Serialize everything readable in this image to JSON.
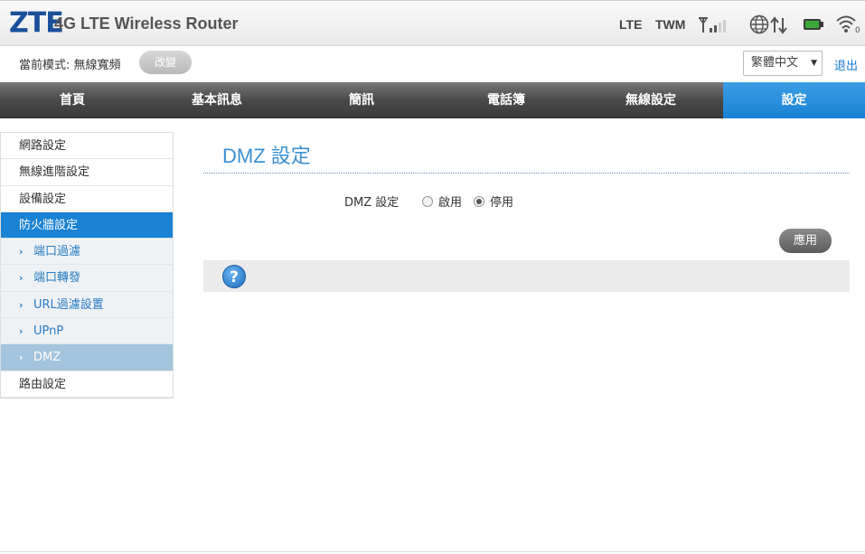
{
  "header": {
    "logo": "ZTE",
    "product": "4G LTE Wireless Router",
    "network_type": "LTE",
    "operator": "TWM",
    "wifi_clients": "0"
  },
  "subbar": {
    "mode_label": "當前模式: 無線寬頻",
    "mode_button": "改變",
    "language": "繁體中文",
    "logout": "退出"
  },
  "nav": {
    "items": [
      {
        "label": "首頁"
      },
      {
        "label": "基本訊息"
      },
      {
        "label": "簡訊"
      },
      {
        "label": "電話簿"
      },
      {
        "label": "無線設定"
      },
      {
        "label": "設定"
      }
    ],
    "active_index": 5
  },
  "sidebar": {
    "items": [
      {
        "label": "網路設定"
      },
      {
        "label": "無線進階設定"
      },
      {
        "label": "設備設定"
      },
      {
        "label": "防火牆設定"
      },
      {
        "label": "路由設定"
      }
    ],
    "subitems": [
      {
        "label": "端口過濾"
      },
      {
        "label": "端口轉發"
      },
      {
        "label": "URL過濾設置"
      },
      {
        "label": "UPnP"
      },
      {
        "label": "DMZ"
      }
    ]
  },
  "main": {
    "title": "DMZ 設定",
    "field_label": "DMZ 設定",
    "options": [
      {
        "label": "啟用",
        "checked": false
      },
      {
        "label": "停用",
        "checked": true
      }
    ],
    "apply": "應用"
  },
  "colors": {
    "accent": "#1a82d4",
    "logo": "#1b4f9a"
  }
}
